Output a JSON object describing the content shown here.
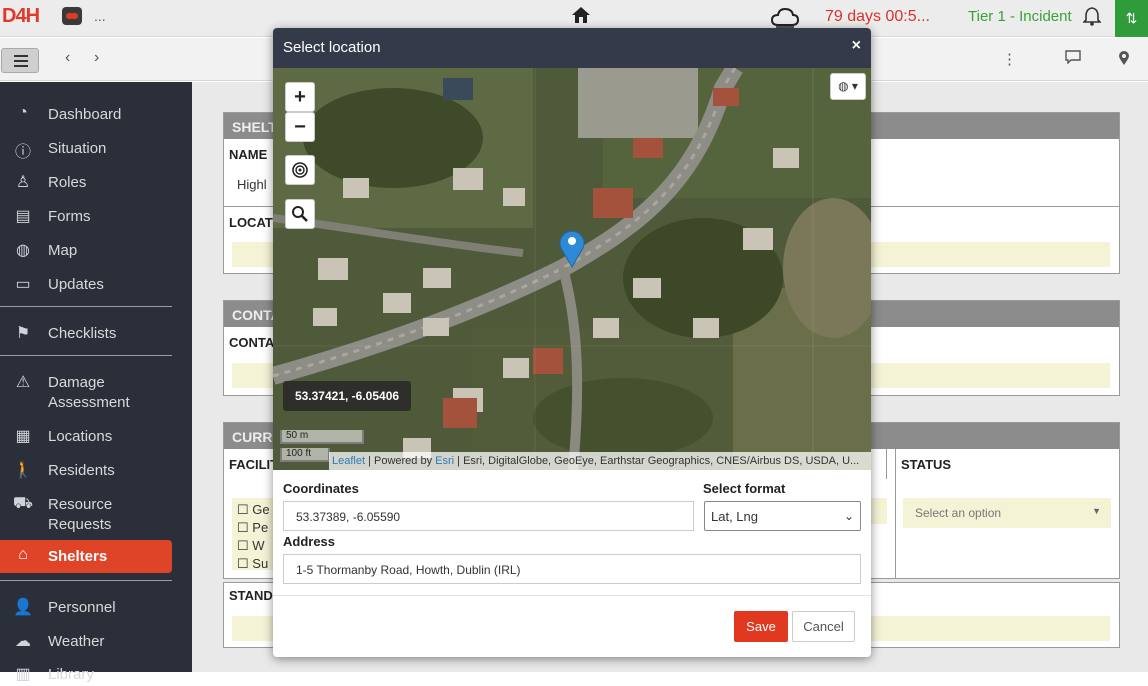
{
  "header": {
    "logo": "D4H",
    "menu_dots": "...",
    "timer": "79 days 00:5...",
    "tier": "Tier 1 - Incident"
  },
  "sidebar": {
    "items": [
      {
        "label": "Dashboard",
        "icon": "dashboard-icon"
      },
      {
        "label": "Situation",
        "icon": "info-icon"
      },
      {
        "label": "Roles",
        "icon": "roles-icon"
      },
      {
        "label": "Forms",
        "icon": "forms-icon"
      },
      {
        "label": "Map",
        "icon": "globe-icon"
      },
      {
        "label": "Updates",
        "icon": "chat-icon"
      },
      {
        "label": "Checklists",
        "icon": "flag-icon"
      },
      {
        "label": "Damage Assessment",
        "icon": "warning-icon"
      },
      {
        "label": "Locations",
        "icon": "building-icon"
      },
      {
        "label": "Residents",
        "icon": "person-icon"
      },
      {
        "label": "Resource Requests",
        "icon": "truck-icon"
      },
      {
        "label": "Shelters",
        "icon": "home-icon"
      },
      {
        "label": "Personnel",
        "icon": "user-icon"
      },
      {
        "label": "Weather",
        "icon": "weather-icon"
      },
      {
        "label": "Library",
        "icon": "library-icon"
      }
    ]
  },
  "background_form": {
    "section1_title": "SHELT",
    "name_label": "NAME",
    "name_value": "Highl",
    "location_label": "LOCATI",
    "section2_title": "CONTA",
    "contact_label": "CONTAC",
    "section3_title": "CURR",
    "facilities_label": "FACILIT",
    "checkbox_items": [
      "Ge",
      "Pe",
      "W",
      "Su"
    ],
    "status_label": "STATUS",
    "status_placeholder": "Select an option",
    "standing_label": "STANDI"
  },
  "modal": {
    "title": "Select location",
    "close": "×",
    "map": {
      "zoom_in": "+",
      "zoom_out": "−",
      "coord_popup": "53.37421, -6.05406",
      "scale_metric": "50 m",
      "scale_imperial": "100 ft",
      "attribution_leaflet": "Leaflet",
      "attribution_powered": " | Powered by ",
      "attribution_esri": "Esri",
      "attribution_rest": " | Esri, DigitalGlobe, GeoEye, Earthstar Geographics, CNES/Airbus DS, USDA, U..."
    },
    "coordinates_label": "Coordinates",
    "coordinates_value": "53.37389, -6.05590",
    "format_label": "Select format",
    "format_value": "Lat, Lng",
    "address_label": "Address",
    "address_value": "1-5 Thormanby Road, Howth, Dublin (IRL)",
    "save_label": "Save",
    "cancel_label": "Cancel"
  },
  "colors": {
    "accent": "#e0391f",
    "sidebar_bg": "#2a2f3a",
    "modal_header": "#343a4a",
    "timer": "#d9322a",
    "tier": "#3aa13a"
  }
}
